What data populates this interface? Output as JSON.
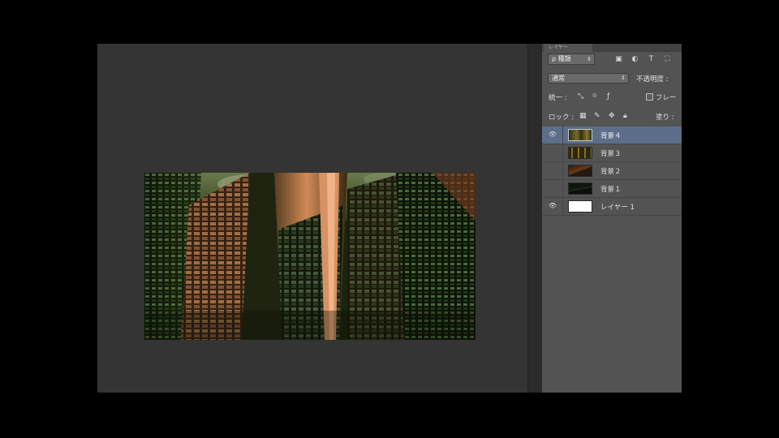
{
  "panel": {
    "tab_label": "レイヤー",
    "filter": {
      "kind_label": "ρ 種類",
      "icons": [
        "image-filter-icon",
        "adjustment-filter-icon",
        "type-filter-icon",
        "shape-filter-icon"
      ]
    },
    "blend": {
      "mode": "通常",
      "opacity_label": "不透明度 :"
    },
    "unify": {
      "label": "統一 :",
      "frame_label": "フレー"
    },
    "lock": {
      "label": "ロック :",
      "fill_label": "塗り :"
    },
    "layers": [
      {
        "name": "背景４",
        "visible": true,
        "selected": true
      },
      {
        "name": "背景３",
        "visible": false,
        "selected": false
      },
      {
        "name": "背景２",
        "visible": false,
        "selected": false
      },
      {
        "name": "背景１",
        "visible": false,
        "selected": false
      },
      {
        "name": "レイヤー 1",
        "visible": true,
        "selected": false
      }
    ]
  },
  "colors": {
    "selected_layer": "#5c6e8a",
    "panel_bg": "#535353",
    "canvas_bg": "#343434"
  }
}
